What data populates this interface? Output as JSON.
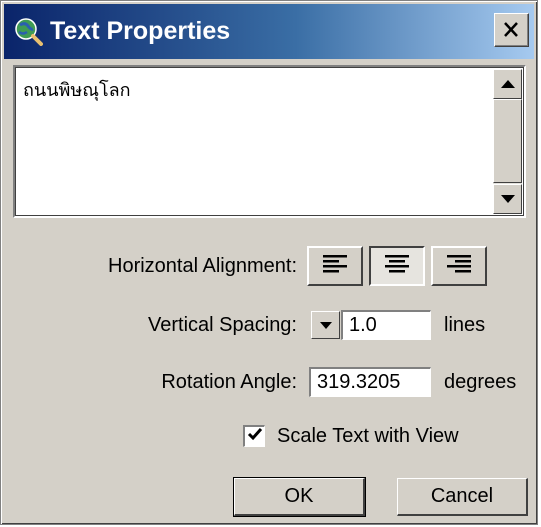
{
  "window": {
    "title": "Text Properties",
    "title_icon": "globe-magnifier-icon",
    "close_icon": "close-icon",
    "titlebar_color_start": "#0a246a",
    "titlebar_color_end": "#a6caf0",
    "face_color": "#d4d0c8"
  },
  "text_content": "ถนนพิษณุโลก",
  "alignment": {
    "label": "Horizontal Alignment:",
    "options": [
      "left",
      "center",
      "right"
    ],
    "selected": "center"
  },
  "vertical_spacing": {
    "label": "Vertical Spacing:",
    "value": "1.0",
    "unit": "lines"
  },
  "rotation": {
    "label": "Rotation Angle:",
    "value": "319.3205",
    "unit": "degrees"
  },
  "scale_text": {
    "label": "Scale Text with View",
    "checked": true
  },
  "buttons": {
    "ok": "OK",
    "cancel": "Cancel"
  }
}
